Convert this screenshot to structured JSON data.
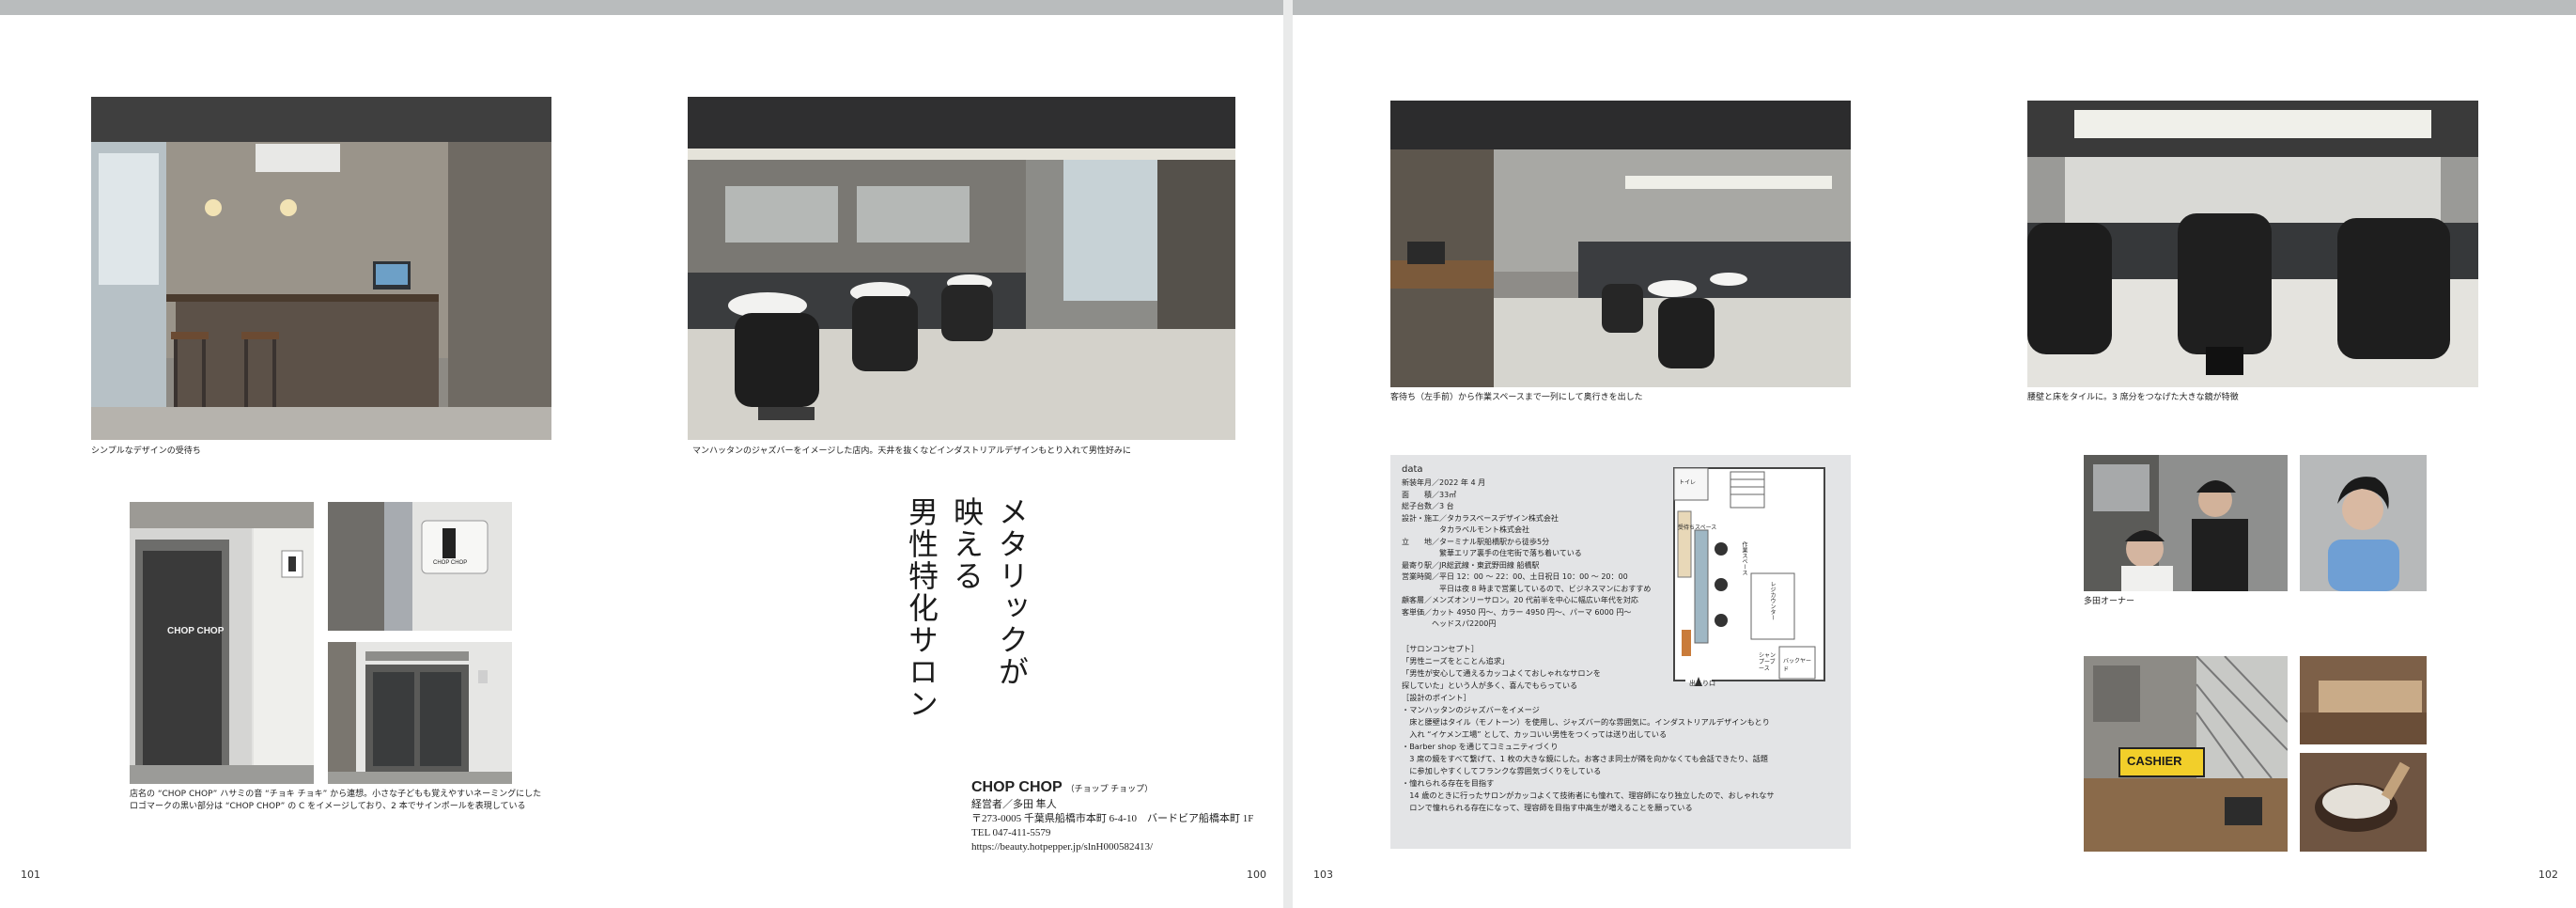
{
  "left_page": {
    "page_numbers": {
      "outer": "101",
      "inner": "100"
    },
    "captions": {
      "photo1": "シンプルなデザインの受待ち",
      "photo2": "マンハッタンのジャズバーをイメージした店内。天井を抜くなどインダストリアルデザインもとり入れて男性好みに",
      "entrance": [
        "店名の “CHOP CHOP” ハサミの音 “チョキ チョキ” から連想。小さな子どもも覚えやすいネーミングにした",
        "ロゴマークの黒い部分は “CHOP CHOP” の C をイメージしており、2 本でサインポールを表現している"
      ]
    },
    "title_columns": [
      "メタリックが",
      "映える",
      "男性特化サロン"
    ],
    "shop": {
      "name": "CHOP CHOP",
      "name_reading": "（チョップ チョップ）",
      "lines": [
        "経営者／多田 隼人",
        "〒273-0005 千葉県船橋市本町 6-4-10　バードビア船橋本町 1F",
        "TEL 047-411-5579",
        "https://beauty.hotpepper.jp/slnH000582413/"
      ]
    },
    "signs": {
      "door_logo": "CHOP CHOP",
      "sign_logo": "CHOP CHOP"
    }
  },
  "right_page": {
    "page_numbers": {
      "outer": "103",
      "inner": "102"
    },
    "captions": {
      "photo1": "客待ち（左手前）から作業スペースまで一列にして奥行きを出した",
      "photo2": "腰壁と床をタイルに。3 席分をつなげた大きな鏡が特徴",
      "owner": "多田オーナー"
    },
    "data_box": {
      "heading": "data",
      "rows": [
        "新装年月／2022 年 4 月",
        "面　　積／33㎡",
        "総子台数／3 台",
        "設計・施工／タカラスペースデザイン株式会社",
        "　　　　　タカラベルモント株式会社",
        "立　　地／ターミナル駅船橋駅から徒歩5分",
        "　　　　　繁華エリア裏手の住宅街で落ち着いている",
        "最寄り駅／JR総武線・東武野田線 船橋駅",
        "営業時間／平日 12：00 ～ 22：00、土日祝日 10：00 ～ 20：00",
        "　　　　　平日は夜 8 時まで営業しているので、ビジネスマンにおすすめ",
        "顧客層／メンズオンリーサロン。20 代前半を中心に幅広い年代を対応",
        "客単価／カット 4950 円～、カラー 4950 円～、パーマ 6000 円～",
        "　　　　ヘッドスパ2200円"
      ],
      "description": [
        "［サロンコンセプト］",
        "「男性ニーズをとことん追求」",
        "「男性が安心して通えるカッコよくておしゃれなサロンを",
        "探していた」という人が多く、喜んでもらっている",
        "［設計のポイント］",
        "・マンハッタンのジャズバーをイメージ",
        "　床と腰壁はタイル（モノトーン）を使用し、ジャズバー的な雰囲気に。インダストリアルデザインもとり",
        "　入れ “イケメン工場” として、カッコいい男性をつくっては送り出している",
        "・Barber shop を通じてコミュニティづくり",
        "　3 席の鏡をすべて繋げて、1 枚の大きな鏡にした。お客さま同士が隣を向かなくても会話できたり、話題",
        "　に参加しやすくしてフランクな雰囲気づくりをしている",
        "・憧れられる存在を目指す",
        "　14 歳のときに行ったサロンがカッコよくて技術者にも憧れて、理容師になり独立したので、おしゃれなサ",
        "　ロンで憧れられる存在になって、理容師を目指す中高生が増えることを願っている"
      ],
      "floor_plan_labels": [
        "トイレ",
        "受待ちスペース",
        "作業スペース",
        "レジカウンター",
        "シャンプーブース",
        "バックヤード",
        "出入り口"
      ]
    },
    "sign_text": "CASHIER",
    "colors": {
      "page_bg": "#ffffff",
      "gutter": "#e9eaea",
      "top_band": "#b9bcbd",
      "data_box": "#e3e4e6"
    }
  }
}
